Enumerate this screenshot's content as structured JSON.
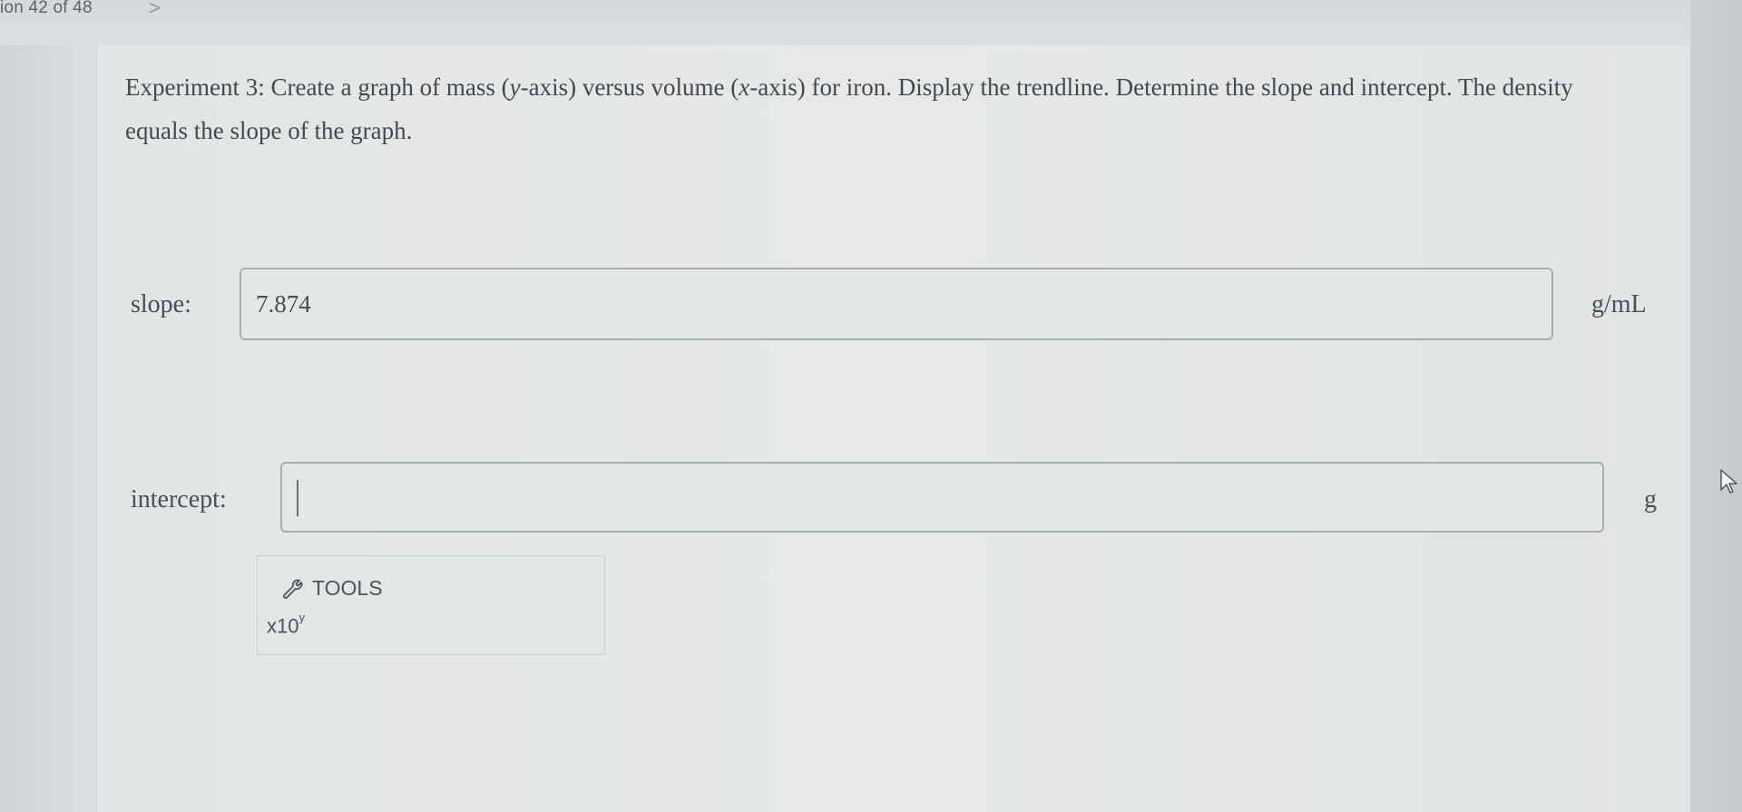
{
  "header": {
    "question_counter": "ion 42 of 48",
    "next_chevron": ">"
  },
  "question": {
    "prompt_before": "Experiment 3: Create a graph of mass (",
    "prompt_y": "y",
    "prompt_mid": "-axis) versus volume (",
    "prompt_x": "x",
    "prompt_after": "-axis) for iron. Display the trendline. Determine the slope and intercept. The density equals the slope of the graph."
  },
  "fields": {
    "slope": {
      "label": "slope:",
      "value": "7.874",
      "unit": "g/mL"
    },
    "intercept": {
      "label": "intercept:",
      "value": "",
      "unit": "g"
    }
  },
  "tools": {
    "label": "TOOLS",
    "icon": "wrench-icon",
    "sci_notation_base": "x10",
    "sci_notation_exp": "y"
  },
  "colors": {
    "background": "#e2e5e6",
    "text": "#45494c",
    "input_border": "#a9adb0"
  }
}
